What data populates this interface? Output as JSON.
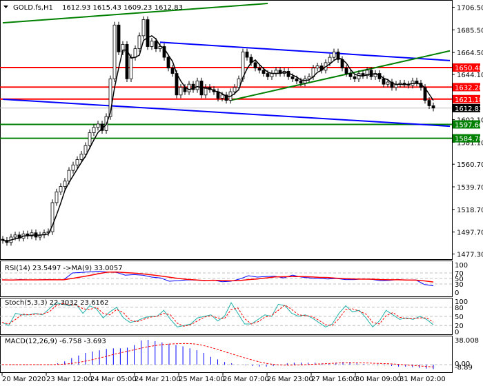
{
  "header": {
    "symbol": "GOLD.fs,H1",
    "ohlc": "1612.93 1615.43 1609.23 1612.83"
  },
  "chart_data": {
    "type": "candlestick",
    "title": "GOLD.fs,H1",
    "ohlc_last": {
      "open": 1612.93,
      "high": 1615.43,
      "low": 1609.23,
      "close": 1612.83
    },
    "ylim": [
      1477.3,
      1706.5
    ],
    "y_ticks": [
      "1706.50",
      "1685.50",
      "1664.50",
      "1644.10",
      "1602.10",
      "1581.10",
      "1560.70",
      "1539.70",
      "1518.70",
      "1497.70",
      "1477.30"
    ],
    "x_ticks": [
      "20 Mar 2020",
      "23 Mar 12:00",
      "24 Mar 05:00",
      "24 Mar 21:00",
      "25 Mar 14:00",
      "26 Mar 07:00",
      "26 Mar 23:00",
      "27 Mar 16:00",
      "30 Mar 09:00",
      "31 Mar 02:00"
    ],
    "closes": [
      1490,
      1488,
      1493,
      1495,
      1492,
      1496,
      1494,
      1497,
      1493,
      1495,
      1497,
      1498,
      1525,
      1535,
      1540,
      1545,
      1555,
      1560,
      1565,
      1570,
      1578,
      1590,
      1595,
      1598,
      1592,
      1605,
      1640,
      1690,
      1665,
      1672,
      1640,
      1660,
      1668,
      1680,
      1695,
      1670,
      1675,
      1668,
      1670,
      1660,
      1650,
      1645,
      1625,
      1632,
      1628,
      1635,
      1630,
      1638,
      1625,
      1632,
      1630,
      1628,
      1622,
      1625,
      1620,
      1628,
      1632,
      1640,
      1665,
      1660,
      1655,
      1650,
      1648,
      1645,
      1642,
      1645,
      1648,
      1645,
      1647,
      1642,
      1640,
      1638,
      1636,
      1640,
      1642,
      1650,
      1652,
      1648,
      1655,
      1660,
      1665,
      1658,
      1650,
      1645,
      1642,
      1640,
      1645,
      1643,
      1648,
      1642,
      1645,
      1640,
      1635,
      1637,
      1632,
      1635,
      1636,
      1635,
      1634,
      1638,
      1636,
      1632,
      1620,
      1615,
      1612.83
    ],
    "ma_period": 4,
    "levels": [
      {
        "label": "1650.48",
        "price": 1650.48,
        "color": "#ff0000"
      },
      {
        "label": "1632.28",
        "price": 1632.28,
        "color": "#ff0000"
      },
      {
        "label": "1621.18",
        "price": 1621.18,
        "color": "#ff0000"
      },
      {
        "label": "1597.66",
        "price": 1597.66,
        "color": "#008000"
      },
      {
        "label": "1584.78",
        "price": 1584.78,
        "color": "#008000"
      }
    ],
    "current_price": {
      "label": "1612.83",
      "price": 1612.83
    },
    "trendlines": [
      {
        "name": "green-channel-top",
        "from": [
          0,
          1692
        ],
        "to": [
          64,
          1710
        ],
        "color": "#008000"
      },
      {
        "name": "blue-channel-lower",
        "from": [
          0,
          1621
        ],
        "to": [
          108,
          1596
        ],
        "color": "#0000ff"
      },
      {
        "name": "blue-channel-upper",
        "from": [
          38,
          1674
        ],
        "to": [
          108,
          1657
        ],
        "color": "#0000ff"
      },
      {
        "name": "green-rising",
        "from": [
          55,
          1620
        ],
        "to": [
          108,
          1666
        ],
        "color": "#008000"
      }
    ],
    "rsi": {
      "label": "RSI(14) 23.5497  ->MA(9) 33.0057",
      "ticks": [
        "100",
        "70",
        "50",
        "30",
        "0"
      ],
      "values": [
        45,
        44,
        46,
        45,
        45,
        46,
        45,
        45,
        70,
        72,
        74,
        76,
        73,
        72,
        62,
        64,
        62,
        55,
        52,
        40,
        42,
        45,
        44,
        42,
        44,
        38,
        40,
        48,
        60,
        55,
        57,
        58,
        52,
        62,
        55,
        52,
        50,
        48,
        50,
        46,
        46,
        48,
        47,
        42,
        43,
        46,
        44,
        45,
        28,
        23.5
      ]
    },
    "stoch": {
      "label": "Stoch(5,3,3) 22.3032 23.6162",
      "ticks": [
        "100",
        "80",
        "50",
        "20",
        "0"
      ],
      "values": [
        30,
        20,
        60,
        55,
        55,
        60,
        55,
        75,
        95,
        90,
        85,
        90,
        60,
        85,
        75,
        45,
        65,
        80,
        45,
        30,
        35,
        45,
        50,
        50,
        70,
        40,
        15,
        20,
        25,
        45,
        50,
        55,
        35,
        50,
        95,
        60,
        25,
        25,
        40,
        55,
        50,
        90,
        85,
        60,
        50,
        55,
        45,
        30,
        15,
        25,
        60,
        85,
        65,
        70,
        45,
        15,
        35,
        70,
        55,
        40,
        45,
        40,
        50,
        40,
        22.3
      ]
    },
    "macd": {
      "label": "MACD(12,26,9) -6.758 -3.693",
      "ticks": [
        "38.008",
        "0.00",
        "-8.89"
      ],
      "values": [
        0,
        0,
        0,
        0,
        0,
        0,
        0,
        0,
        2,
        5,
        10,
        14,
        18,
        20,
        22,
        24,
        25,
        25,
        26,
        30,
        37,
        38,
        36,
        34,
        32,
        30,
        28,
        25,
        22,
        18,
        12,
        8,
        4,
        2,
        0,
        -1,
        -2,
        -3,
        -3,
        -2,
        0,
        2,
        3,
        3,
        3,
        3,
        2,
        2,
        3,
        4,
        4,
        2,
        1,
        0,
        -1,
        -1,
        -2,
        -3,
        -3,
        -4,
        -5,
        -6,
        -6.8
      ]
    }
  }
}
